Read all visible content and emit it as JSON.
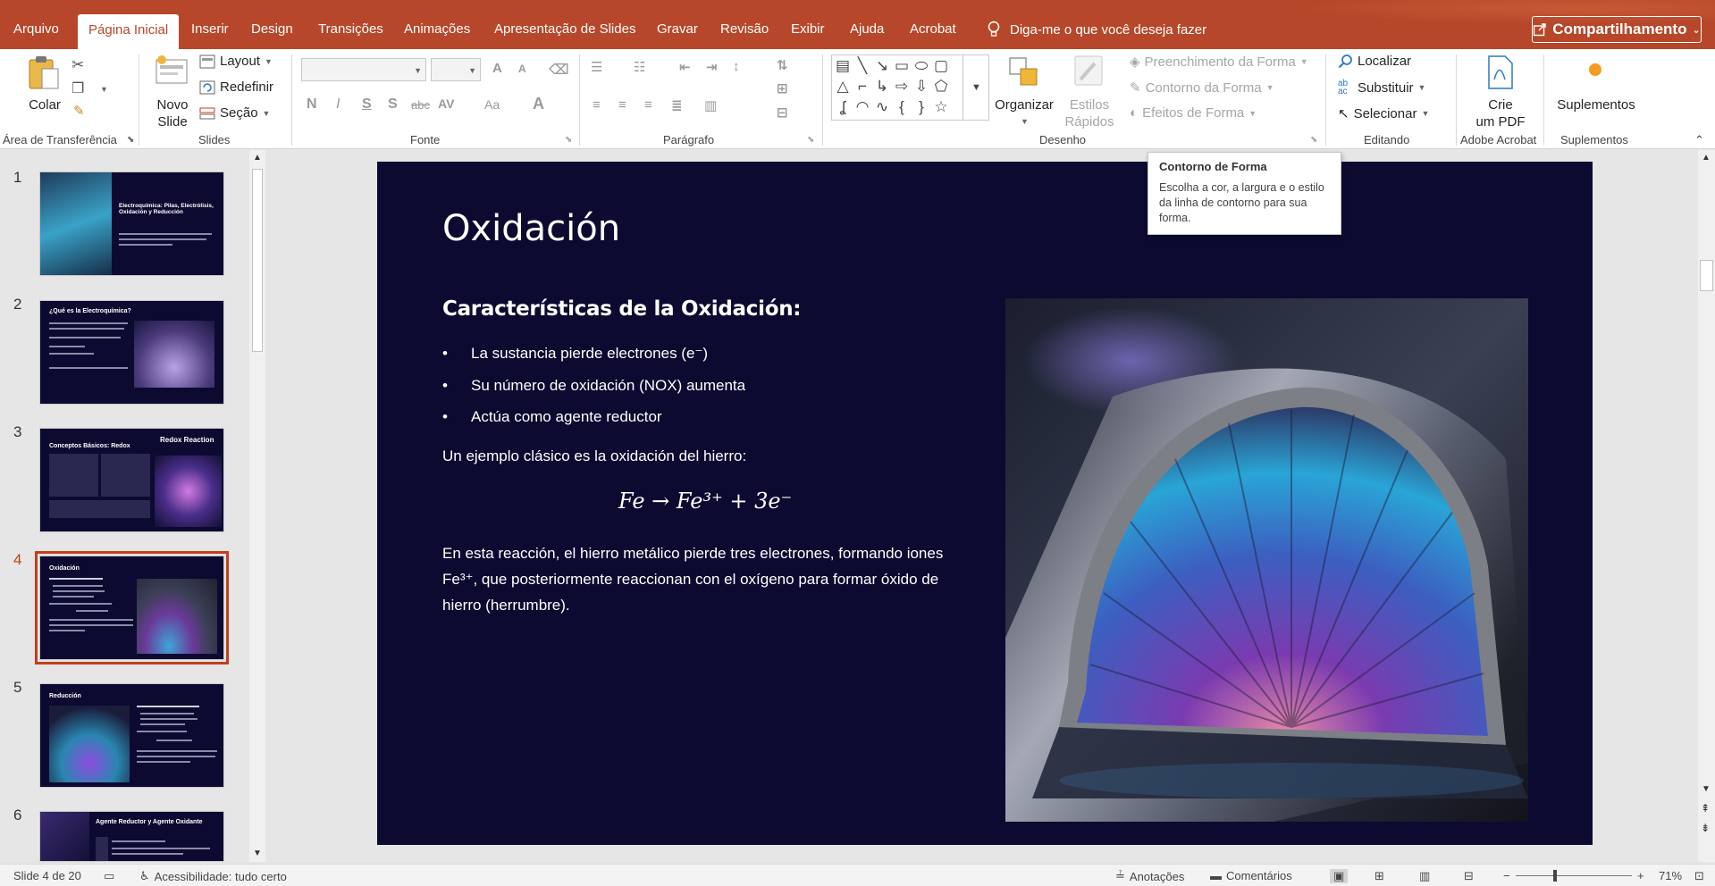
{
  "tabs": [
    {
      "label": "Arquivo",
      "active": false
    },
    {
      "label": "Página Inicial",
      "active": true
    },
    {
      "label": "Inserir",
      "active": false
    },
    {
      "label": "Design",
      "active": false
    },
    {
      "label": "Transições",
      "active": false
    },
    {
      "label": "Animações",
      "active": false
    },
    {
      "label": "Apresentação de Slides",
      "active": false
    },
    {
      "label": "Gravar",
      "active": false
    },
    {
      "label": "Revisão",
      "active": false
    },
    {
      "label": "Exibir",
      "active": false
    },
    {
      "label": "Ajuda",
      "active": false
    },
    {
      "label": "Acrobat",
      "active": false
    }
  ],
  "tell_me": "Diga-me o que você deseja fazer",
  "share": "Compartilhamento",
  "ribbon": {
    "clipboard": {
      "paste": "Colar",
      "label": "Área de Transferência"
    },
    "slides": {
      "new_slide_1": "Novo",
      "new_slide_2": "Slide",
      "layout": "Layout",
      "reset": "Redefinir",
      "section": "Seção",
      "label": "Slides"
    },
    "font": {
      "label": "Fonte",
      "bold": "N",
      "italic": "I",
      "underline": "S",
      "shadow": "S",
      "strike": "abc",
      "spacing": "AV",
      "case": "Aa",
      "color": "A",
      "grow": "A",
      "shrink": "A"
    },
    "paragraph": {
      "label": "Parágrafo"
    },
    "drawing": {
      "arrange": "Organizar",
      "styles_1": "Estilos",
      "styles_2": "Rápidos",
      "fill": "Preenchimento da Forma",
      "outline": "Contorno da Forma",
      "effects": "Efeitos de Forma",
      "label": "Desenho"
    },
    "editing": {
      "find": "Localizar",
      "replace": "Substituir",
      "select": "Selecionar",
      "label": "Editando"
    },
    "acrobat": {
      "create_1": "Crie",
      "create_2": "um PDF",
      "label": "Adobe Acrobat"
    },
    "addins": {
      "button": "Suplementos",
      "label": "Suplementos"
    }
  },
  "tooltip": {
    "title": "Contorno de Forma",
    "body": "Escolha a cor, a largura e o estilo da linha de contorno para sua forma."
  },
  "thumbnails": [
    {
      "number": "1",
      "title": "Electroquímica: Pilas, Electrólisis, Oxidación y Reducción"
    },
    {
      "number": "2",
      "title": "¿Qué es la Electroquímica?"
    },
    {
      "number": "3",
      "title": "Conceptos Básicos: Redox",
      "extra": "Redox Reaction"
    },
    {
      "number": "4",
      "title": "Oxidación",
      "active": true
    },
    {
      "number": "5",
      "title": "Reducción"
    },
    {
      "number": "6",
      "title": "Agente Reductor y Agente Oxidante"
    }
  ],
  "slide": {
    "title": "Oxidación",
    "subtitle": "Características de la Oxidación:",
    "bullets": [
      "La sustancia pierde electrones (e⁻)",
      "Su número de oxidación (NOX) aumenta",
      "Actúa como agente reductor"
    ],
    "example": "Un ejemplo clásico es la oxidación del hierro:",
    "equation": "Fe →  Fe³⁺ + 3e⁻",
    "explanation": "En esta reacción, el hierro metálico pierde tres electrones, formando iones Fe³⁺, que posteriormente reaccionan con el oxígeno para formar óxido de hierro (herrumbre)."
  },
  "status": {
    "slide_info": "Slide 4 de 20",
    "accessibility": "Acessibilidade: tudo certo",
    "notes": "Anotações",
    "comments": "Comentários",
    "zoom": "71%",
    "zoom_level": 0.71
  },
  "colors": {
    "accent": "#b7472a",
    "slide_bg": "#0c0a30",
    "active_thumb": "#c43e1c"
  }
}
